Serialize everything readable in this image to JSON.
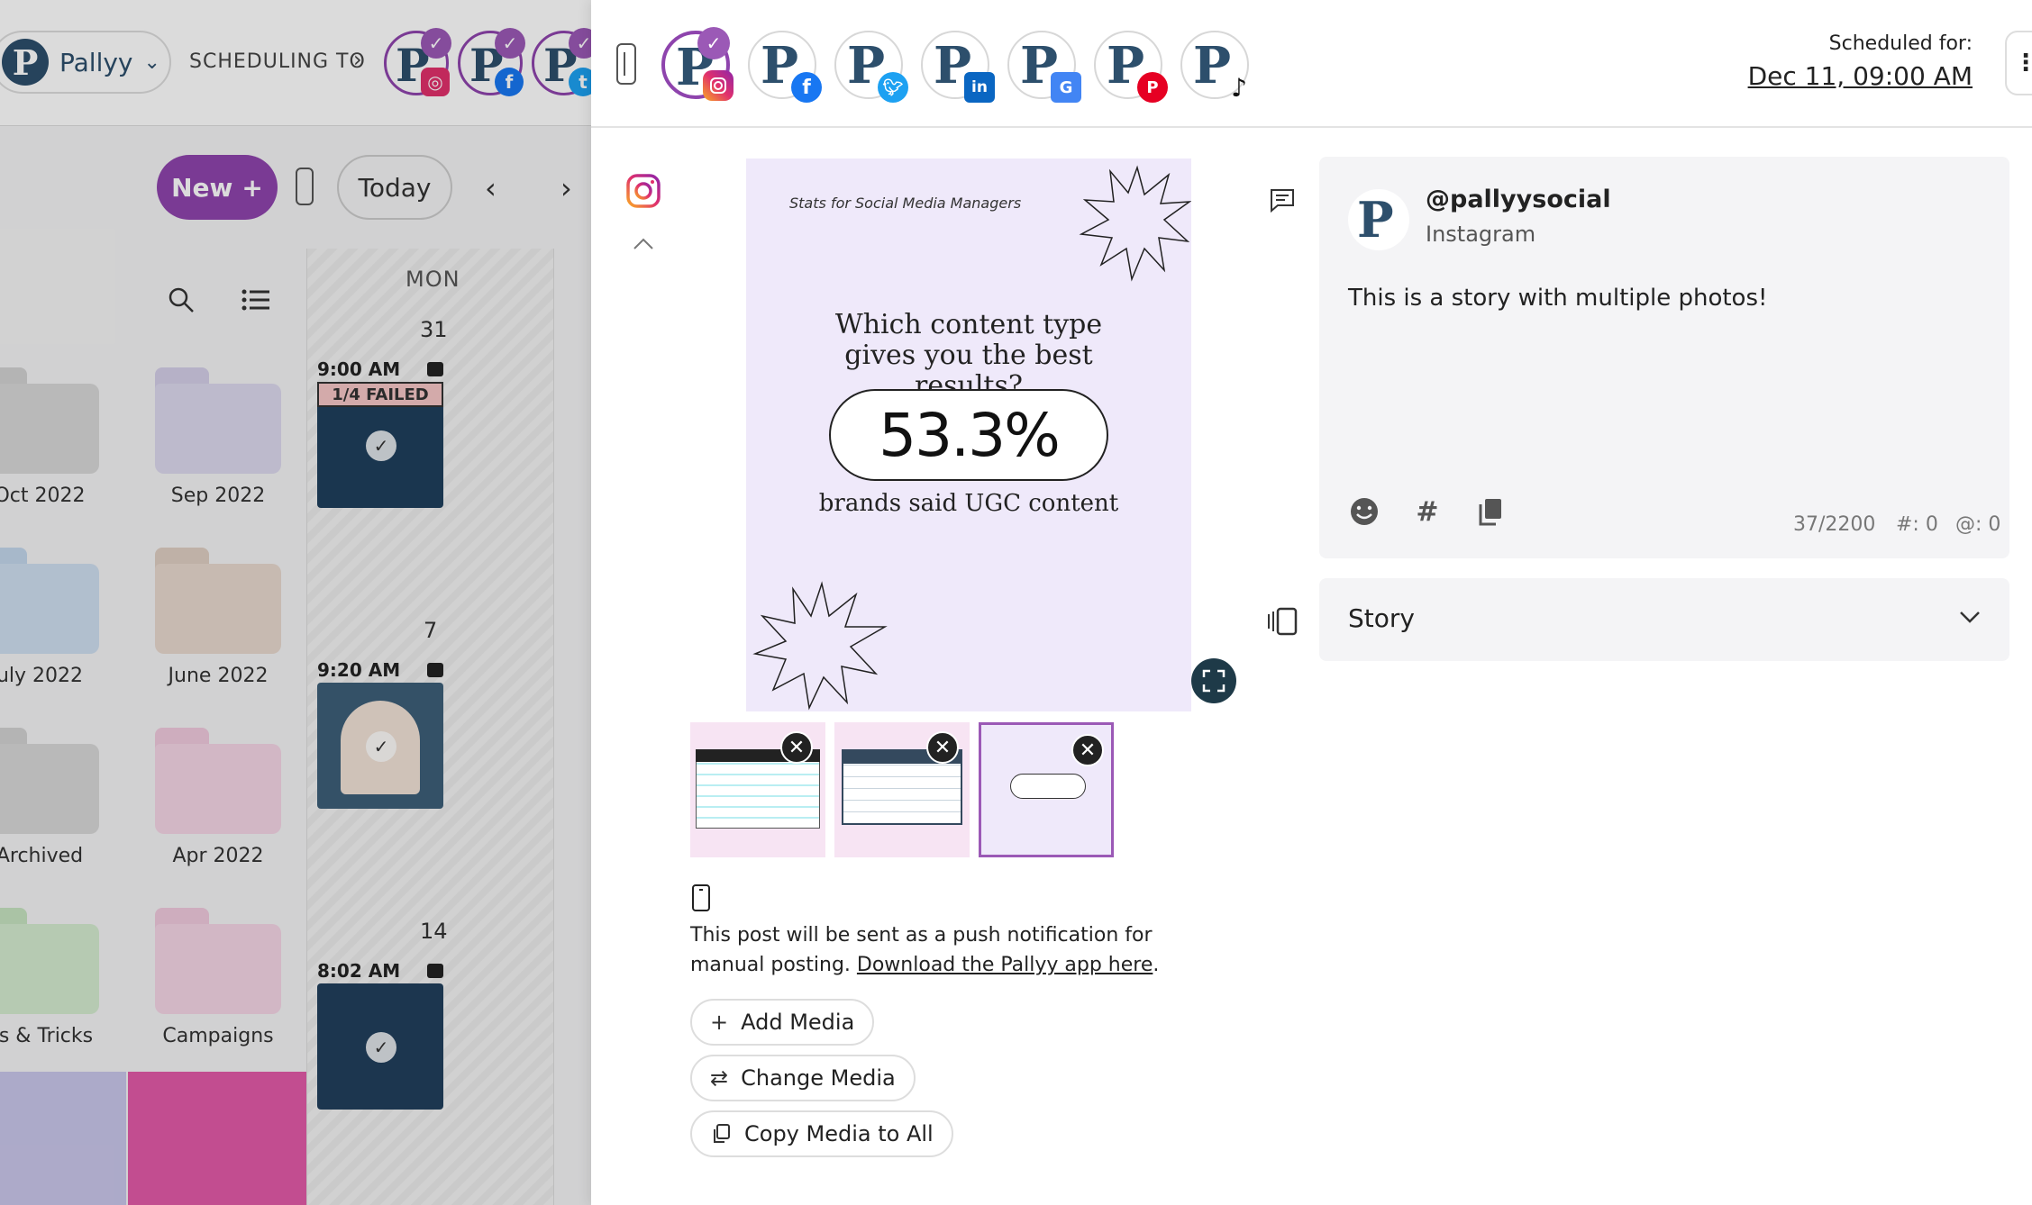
{
  "background": {
    "workspace": {
      "name": "Pallyy"
    },
    "scheduling_label": "SCHEDULING TO",
    "new_button": "New",
    "today_button": "Today",
    "folders": [
      {
        "label": "Oct 2022",
        "color": "#d8d8d8"
      },
      {
        "label": "Sep 2022",
        "color": "#ddd9ee"
      },
      {
        "label": "uly 2022",
        "color": "#cfdff0"
      },
      {
        "label": "June 2022",
        "color": "#e8d9cf"
      },
      {
        "label": "Archived",
        "color": "#d8d8d8"
      },
      {
        "label": "Apr 2022",
        "color": "#f5d6e6"
      },
      {
        "label": "ps & Tricks",
        "color": "#d4ecd0"
      },
      {
        "label": "Campaigns",
        "color": "#f5d6e6"
      }
    ],
    "calendar": {
      "day_header": "MON",
      "days": [
        {
          "date": "31",
          "time": "9:00 AM",
          "badge": "1/4 FAILED"
        },
        {
          "date": "7",
          "time": "9:20 AM"
        },
        {
          "date": "14",
          "time": "8:02 AM"
        }
      ]
    }
  },
  "panel": {
    "accounts": [
      {
        "network": "instagram-icon",
        "selected": true
      },
      {
        "network": "facebook-icon",
        "selected": false
      },
      {
        "network": "twitter-icon",
        "selected": false
      },
      {
        "network": "linkedin-icon",
        "selected": false
      },
      {
        "network": "google-business-icon",
        "selected": false
      },
      {
        "network": "pinterest-icon",
        "selected": false
      },
      {
        "network": "tiktok-icon",
        "selected": false
      }
    ],
    "scheduled_for_label": "Scheduled for:",
    "scheduled_date": "Dec 11, 09:00 AM",
    "preview": {
      "kicker": "Stats for Social Media Managers",
      "question": "Which content type gives you the best results?",
      "stat": "53.3%",
      "subtitle": "brands said UGC content"
    },
    "push_note_text": "This post will be sent as a push notification for manual posting. ",
    "push_note_link": "Download the Pallyy app here",
    "push_note_end": ".",
    "buttons": {
      "add_media": "Add Media",
      "change_media": "Change Media",
      "copy_media": "Copy Media to All"
    },
    "post_card": {
      "handle": "@pallyysocial",
      "network": "Instagram",
      "caption": "This is a story with multiple photos!",
      "char_count": "37/2200",
      "hashtag_count": "#: 0",
      "mention_count": "@: 0"
    },
    "post_type": "Story"
  },
  "colors": {
    "accent": "#8e44ad",
    "brand_navy": "#2d4f6c",
    "instagram": "#e1306c",
    "facebook": "#1877f2",
    "twitter": "#1da1f2",
    "linkedin": "#0a66c2",
    "google": "#4285f4",
    "pinterest": "#e60023",
    "tiktok": "#111111"
  }
}
